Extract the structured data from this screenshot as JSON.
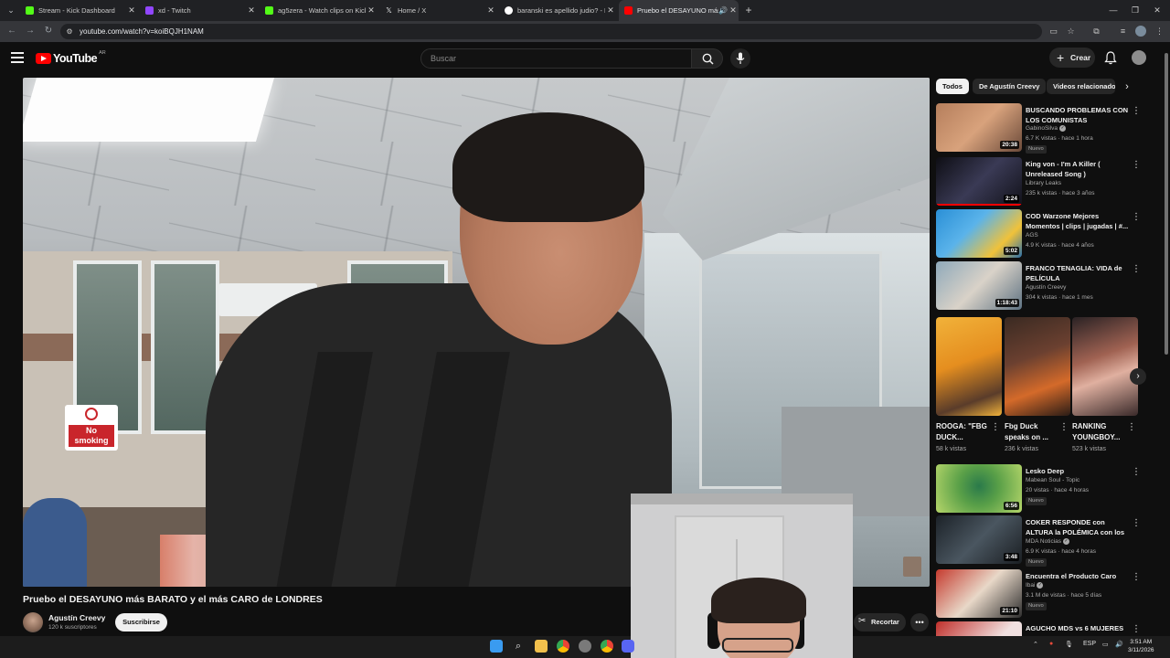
{
  "browser": {
    "tabs": [
      {
        "label": "Stream - Kick Dashboard",
        "favicon_color": "#53fc18",
        "active": false
      },
      {
        "label": "xd - Twitch",
        "favicon_color": "#9146ff",
        "active": false
      },
      {
        "label": "ag5zera - Watch clips on Kick",
        "favicon_color": "#53fc18",
        "active": false
      },
      {
        "label": "Home / X",
        "favicon_color": "#e7e9ea",
        "active": false
      },
      {
        "label": "baranski es apellido judio? - Bu",
        "favicon_color": "#4285f4",
        "active": false
      },
      {
        "label": "Pruebo el DESAYUNO más",
        "favicon_color": "#ff0000",
        "active": true
      }
    ],
    "url": "youtube.com/watch?v=koiBQJH1NAM"
  },
  "header": {
    "logo_text": "YouTube",
    "region": "AR",
    "search_placeholder": "Buscar",
    "create_label": "Crear"
  },
  "video": {
    "title": "Pruebo el DESAYUNO más BARATO y el más CARO de LONDRES",
    "sign_text": "No smoking"
  },
  "channel": {
    "name": "Agustín Creevy",
    "subscribers": "120 k suscriptores",
    "subscribe_label": "Suscribirse"
  },
  "actions": {
    "clip_label": "Recortar",
    "more_label": "•••"
  },
  "chips": [
    {
      "label": "Todos",
      "active": true
    },
    {
      "label": "De Agustín Creevy",
      "active": false
    },
    {
      "label": "Videos relacionado",
      "active": false
    }
  ],
  "recommendations": [
    {
      "title": "BUSCANDO PROBLEMAS CON LOS COMUNISTAS",
      "channel": "GabinoSilva",
      "verified": true,
      "meta": "6.7 K vistas · hace 1 hora",
      "duration": "20:38",
      "badge": "Nuevo",
      "thumb_color": "#a36f4f",
      "progress": 0
    },
    {
      "title": "King von - I'm A Killer ( Unreleased Song )",
      "channel": "Library Leaks",
      "verified": false,
      "meta": "235 k vistas · hace 3 años",
      "duration": "2:24",
      "badge": "",
      "thumb_color": "#1c1c2a",
      "progress": 1.0
    },
    {
      "title": "COD Warzone Mejores Momentos | clips | jugadas | #...",
      "channel": "AGS",
      "verified": false,
      "meta": "4.9 K vistas · hace 4 años",
      "duration": "5:02",
      "badge": "",
      "thumb_color": "#2c8fce",
      "progress": 0
    },
    {
      "title": "FRANCO TENAGLIA: VIDA de PELÍCULA",
      "channel": "Agustín Creevy",
      "verified": false,
      "meta": "304 k vistas · hace 1 mes",
      "duration": "1:18:43",
      "badge": "",
      "thumb_color": "#5d7e93",
      "progress": 0
    },
    {
      "title": "Lesko Deep",
      "channel": "Mabean Soul - Topic",
      "verified": false,
      "meta": "20 vistas · hace 4 horas",
      "duration": "6:56",
      "badge": "Nuevo",
      "thumb_color": "#8fbf3b",
      "progress": 0
    },
    {
      "title": "COKER RESPONDE con ALTURA la POLÉMICA con los ...",
      "channel": "MDA Noticias",
      "verified": true,
      "meta": "6.9 K vistas · hace 4 horas",
      "duration": "3:48",
      "badge": "Nuevo",
      "thumb_color": "#39434d",
      "progress": 0
    },
    {
      "title": "Encuentra el Producto Caro",
      "channel": "Ibai",
      "verified": true,
      "meta": "3.1 M de vistas · hace 5 días",
      "duration": "21:10",
      "badge": "Nuevo",
      "thumb_color": "#b8322b",
      "progress": 0
    },
    {
      "title": "AGUCHO MDS vs 6 MUJERES",
      "channel": "",
      "verified": false,
      "meta": "",
      "duration": "",
      "badge": "",
      "thumb_color": "#c02f2a",
      "progress": 0
    }
  ],
  "shorts": [
    {
      "title": "ROOGA: \"FBG DUCK...",
      "views": "58 k vistas",
      "thumb_color": "#e5a02a"
    },
    {
      "title": "Fbg Duck speaks on ...",
      "views": "236 k vistas",
      "thumb_color": "#c4623a"
    },
    {
      "title": "RANKING YOUNGBOY...",
      "views": "523 k vistas",
      "thumb_color": "#8a4c3e"
    }
  ],
  "taskbar": {
    "lang": "ESP",
    "time": "3:51 AM",
    "date": "3/11/2026"
  }
}
